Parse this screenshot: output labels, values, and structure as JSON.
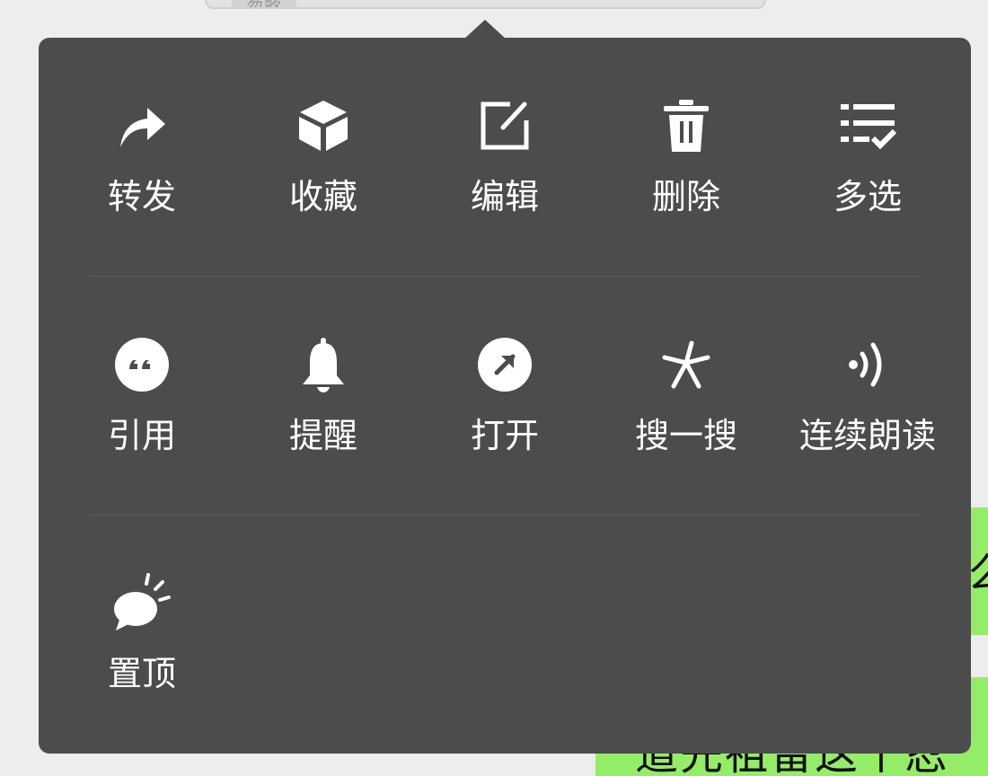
{
  "background": {
    "top_bubble_chip": "忽略",
    "green_bubble_1_text": "么",
    "green_bubble_2_text": "道先祖留这个忍"
  },
  "popup": {
    "rows": [
      [
        {
          "label": "转发",
          "icon": "forward-arrow-icon"
        },
        {
          "label": "收藏",
          "icon": "cube-icon"
        },
        {
          "label": "编辑",
          "icon": "edit-icon"
        },
        {
          "label": "删除",
          "icon": "trash-icon"
        },
        {
          "label": "多选",
          "icon": "multi-select-icon"
        }
      ],
      [
        {
          "label": "引用",
          "icon": "quote-icon"
        },
        {
          "label": "提醒",
          "icon": "bell-icon"
        },
        {
          "label": "打开",
          "icon": "open-arrow-icon"
        },
        {
          "label": "搜一搜",
          "icon": "search-spark-icon"
        },
        {
          "label": "连续朗读",
          "icon": "speaker-icon"
        }
      ],
      [
        {
          "label": "置顶",
          "icon": "pin-bubble-icon"
        }
      ]
    ]
  },
  "colors": {
    "popup_background": "#4c4c4c",
    "chat_background": "#ededed",
    "bubble_green": "#95ec69",
    "label_text": "#ffffff"
  }
}
